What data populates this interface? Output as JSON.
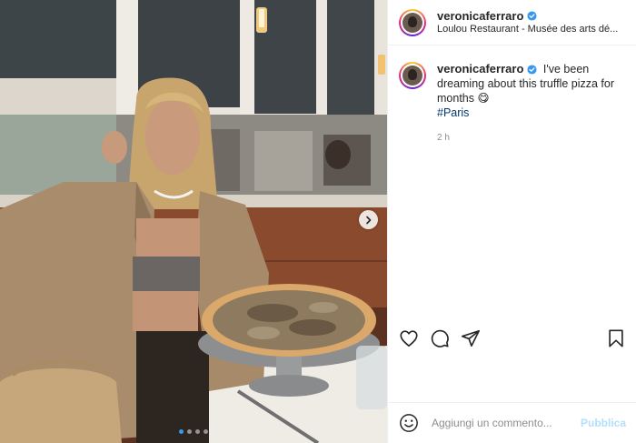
{
  "post": {
    "username": "veronicaferraro",
    "location": "Loulou Restaurant - Musée des arts dé...",
    "caption_text": "I've been dreaming about this truffle pizza for months 😋",
    "hashtag": "#Paris",
    "time_ago": "2 h"
  },
  "comment": {
    "placeholder": "Aggiungi un commento...",
    "publish_label": "Pubblica"
  },
  "carousel": {
    "slide_count": 4,
    "active_index": 0
  },
  "colors": {
    "verified": "#3897f0",
    "link": "#00376b",
    "publish_disabled": "#b2dffc",
    "muted": "#8e8e8e"
  },
  "icons": [
    "chevron-right-icon",
    "verified-badge-icon",
    "heart-icon",
    "comment-icon",
    "share-icon",
    "bookmark-icon",
    "emoji-icon"
  ]
}
